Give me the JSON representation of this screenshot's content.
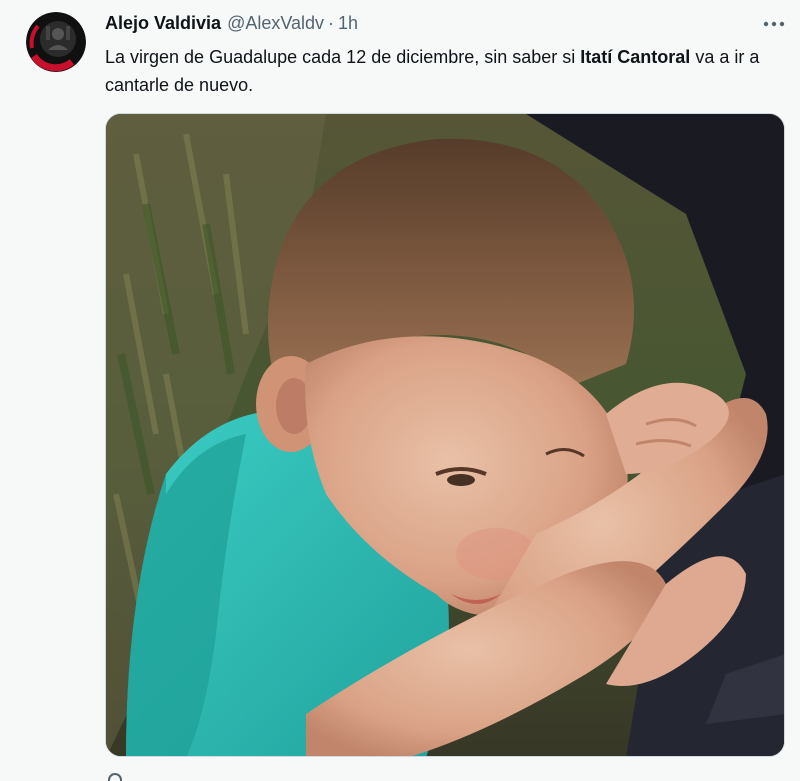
{
  "tweet": {
    "author": {
      "name": "Alejo Valdivia",
      "handle": "@AlexValdv",
      "separator": "·",
      "time": "1h",
      "avatar_icon": "profile-avatar"
    },
    "text": {
      "part1": "La virgen de Guadalupe cada 12 de diciembre, sin saber si ",
      "bold": "Itatí Cantoral",
      "part2": " va a ir a cantarle de nuevo."
    },
    "more_icon": "more-options-icon",
    "media": {
      "kind": "photo",
      "subject": "toddler in turquoise shirt hugging an arm"
    }
  },
  "colors": {
    "text_primary": "#0f1419",
    "text_secondary": "#536471",
    "background": "#f7f9f9",
    "shirt": "#2ec9c0"
  }
}
